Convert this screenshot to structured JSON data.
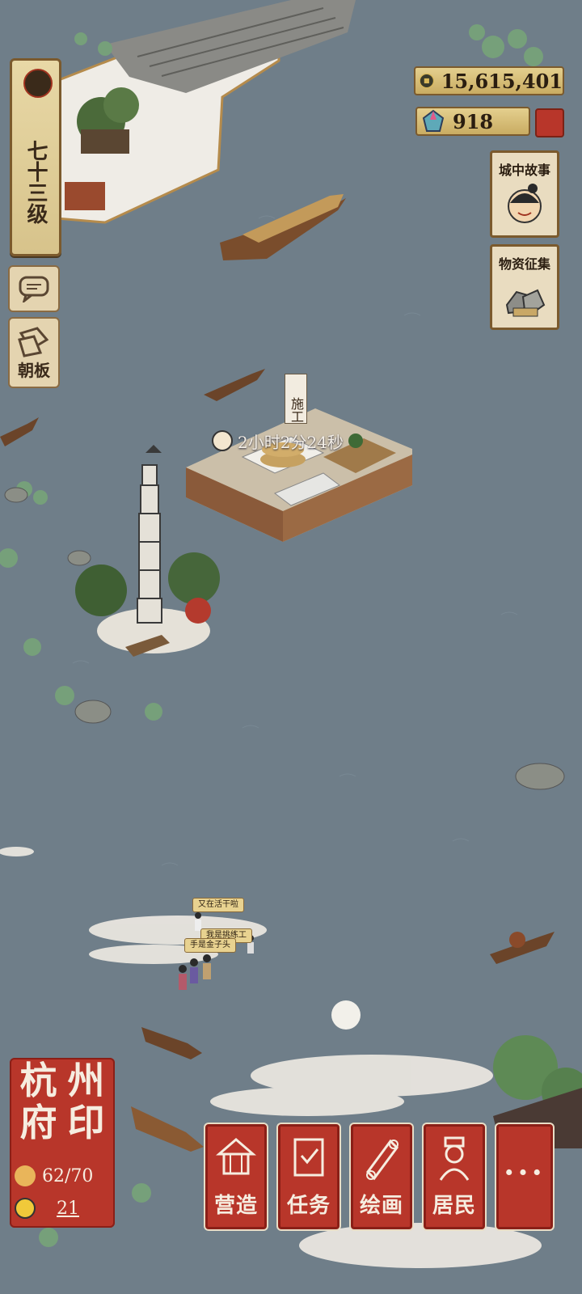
{
  "level": {
    "text": "七十三级"
  },
  "side_buttons": {
    "chat_label": "",
    "board_label": "朝板"
  },
  "resources": {
    "coins": "15,615,401",
    "gems": "918"
  },
  "events": [
    {
      "label": "城中故事",
      "icon": "child-face-icon"
    },
    {
      "label": "物资征集",
      "icon": "stone-pile-icon"
    }
  ],
  "construction": {
    "sign": "施工",
    "timer": "2小时2分24秒"
  },
  "bubbles": {
    "b1": "又在活干啦",
    "b2": "我是挑练工",
    "b3": "手是金子头"
  },
  "city": {
    "name_chars": [
      "杭",
      "州",
      "府",
      "印"
    ],
    "population": "62/70",
    "happiness": "21"
  },
  "menu": {
    "build": "营造",
    "tasks": "任务",
    "painting": "绘画",
    "residents": "居民",
    "more": "···"
  },
  "colors": {
    "water": "#6f7e89",
    "seal_red": "#b8362a",
    "paper": "#e9dcc0"
  }
}
